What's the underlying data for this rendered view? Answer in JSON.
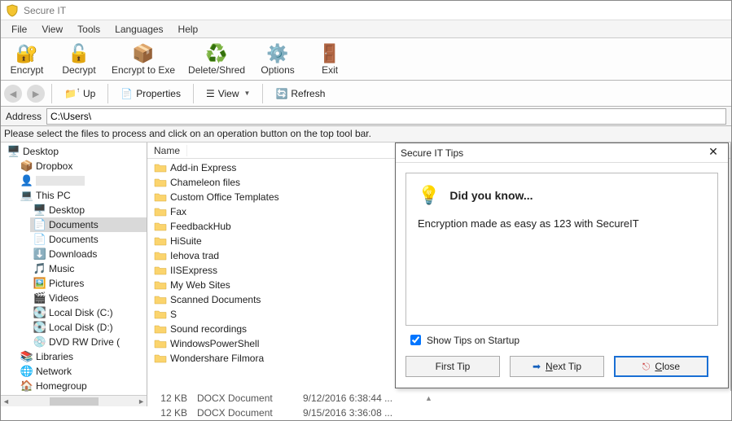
{
  "title": "Secure IT",
  "menu": [
    "File",
    "View",
    "Tools",
    "Languages",
    "Help"
  ],
  "toolbar1": [
    {
      "id": "encrypt",
      "label": "Encrypt"
    },
    {
      "id": "decrypt",
      "label": "Decrypt"
    },
    {
      "id": "enctoexe",
      "label": "Encrypt to Exe"
    },
    {
      "id": "delete",
      "label": "Delete/Shred"
    },
    {
      "id": "options",
      "label": "Options"
    },
    {
      "id": "exit",
      "label": "Exit"
    }
  ],
  "toolbar2": {
    "up": "Up",
    "properties": "Properties",
    "view": "View",
    "refresh": "Refresh"
  },
  "address": {
    "label": "Address",
    "value": "C:\\Users\\"
  },
  "instruction": "Please select the files to process and click on an operation button on the top tool bar.",
  "tree": [
    {
      "label": "Desktop",
      "icon": "desktop",
      "indent": 0
    },
    {
      "label": "Dropbox",
      "icon": "dropbox",
      "indent": 1
    },
    {
      "label": "",
      "icon": "user",
      "indent": 1,
      "blurred": true
    },
    {
      "label": "This PC",
      "icon": "pc",
      "indent": 1
    },
    {
      "label": "Desktop",
      "icon": "desktop-b",
      "indent": 2
    },
    {
      "label": "Documents",
      "icon": "doc",
      "indent": 2,
      "selected": true
    },
    {
      "label": "Documents",
      "icon": "doc",
      "indent": 2
    },
    {
      "label": "Downloads",
      "icon": "dl",
      "indent": 2
    },
    {
      "label": "Music",
      "icon": "music",
      "indent": 2
    },
    {
      "label": "Pictures",
      "icon": "pic",
      "indent": 2
    },
    {
      "label": "Videos",
      "icon": "vid",
      "indent": 2
    },
    {
      "label": "Local Disk (C:)",
      "icon": "disk",
      "indent": 2
    },
    {
      "label": "Local Disk (D:)",
      "icon": "disk",
      "indent": 2
    },
    {
      "label": "DVD RW Drive (",
      "icon": "dvd",
      "indent": 2
    },
    {
      "label": "Libraries",
      "icon": "lib",
      "indent": 1
    },
    {
      "label": "Network",
      "icon": "net",
      "indent": 1
    },
    {
      "label": "Homegroup",
      "icon": "home",
      "indent": 1
    }
  ],
  "filelist": {
    "column": "Name",
    "items": [
      "Add-in Express",
      "Chameleon files",
      "Custom Office Templates",
      "Fax",
      "FeedbackHub",
      "HiSuite",
      "Iehova trad",
      "IISExpress",
      "My Web Sites",
      "Scanned Documents",
      "S",
      "Sound recordings",
      "WindowsPowerShell",
      "Wondershare Filmora"
    ]
  },
  "detail_rows": [
    {
      "size": "12 KB",
      "type": "DOCX Document",
      "date": "9/12/2016 6:38:44 ..."
    },
    {
      "size": "12 KB",
      "type": "DOCX Document",
      "date": "9/15/2016 3:36:08 ..."
    }
  ],
  "dialog": {
    "title": "Secure IT Tips",
    "heading": "Did you know...",
    "tip": "Encryption made as easy as 123 with SecureIT",
    "show_tips": "Show Tips on Startup",
    "show_tips_checked": true,
    "btn_first": "First Tip",
    "btn_next": "Next Tip",
    "btn_close": "Close"
  }
}
